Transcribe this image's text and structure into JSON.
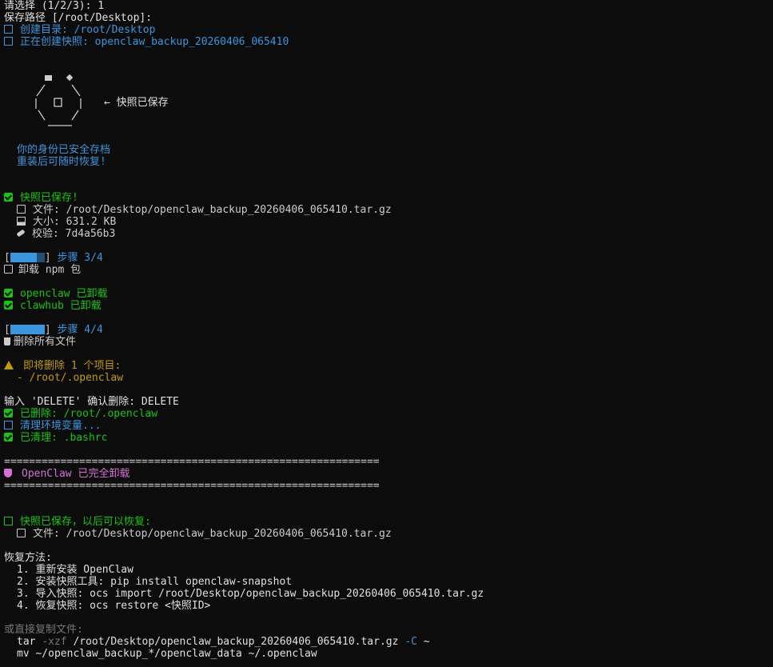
{
  "prompt": {
    "select": "请选择 (1/2/3): 1",
    "save_path": "保存路径 [/root/Desktop]:"
  },
  "progress_msgs": {
    "mkdir": "创建目录: /root/Desktop",
    "creating": "正在创建快照: openclaw_backup_20260406_065410"
  },
  "art": {
    "label": "← 快照已保存",
    "line1": "你的身份已安全存档",
    "line2": "重装后可随时恢复!"
  },
  "snapshot": {
    "saved": "快照已保存!",
    "file": "文件: /root/Desktop/openclaw_backup_20260406_065410.tar.gz",
    "size": "大小: 631.2 KB",
    "checksum": "校验: 7d4a56b3"
  },
  "step3": {
    "open": "[",
    "close": "]",
    "label": "步骤 3/4",
    "title": "卸载 npm 包",
    "item1": "openclaw 已卸载",
    "item2": "clawhub 已卸载"
  },
  "step4": {
    "open": "[",
    "close": "]",
    "label": "步骤 4/4",
    "title": "删除所有文件",
    "warn": "即将删除 1 个项目:",
    "target": "- /root/.openclaw",
    "confirm": "输入 'DELETE' 确认删除: DELETE",
    "deleted": "已删除: /root/.openclaw",
    "cleaning": "清理环境变量...",
    "cleaned": "已清理: .bashrc"
  },
  "summary": {
    "rule": "============================================================",
    "done": "OpenClaw 已完全卸载",
    "saved": "快照已保存，以后可以恢复:",
    "file": "文件: /root/Desktop/openclaw_backup_20260406_065410.tar.gz"
  },
  "restore": {
    "heading": "恢复方法:",
    "steps": [
      "1. 重新安装 OpenClaw",
      "2. 安装快照工具: pip install openclaw-snapshot",
      "3. 导入快照: ocs import /root/Desktop/openclaw_backup_20260406_065410.tar.gz",
      "4. 恢复快照: ocs restore <快照ID>"
    ],
    "alt_heading": "或直接复制文件:",
    "tar_cmd": "tar",
    "tar_flag": "-xzf",
    "tar_path": "/root/Desktop/openclaw_backup_20260406_065410.tar.gz",
    "tar_c": "-C",
    "tar_dest": "~",
    "mv_cmd": "mv ~/openclaw_backup_*/openclaw_data ~/.openclaw"
  },
  "progress": {
    "step3_fraction": 0.75,
    "step4_fraction": 1.0
  },
  "colors": {
    "background": "#0c0c0c",
    "text": "#cccccc",
    "cyan": "#3a96dd",
    "green": "#16c60c",
    "yellow": "#c19c00",
    "magenta": "#d670d6",
    "gray": "#767676"
  }
}
